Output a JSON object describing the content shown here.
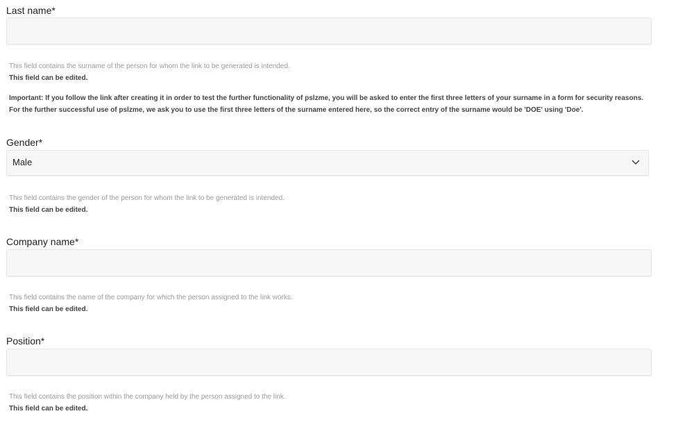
{
  "fields": {
    "last_name": {
      "label": "Last name*",
      "value": "",
      "help": "This field contains the surname of the person for whom the link to be generated is intended.",
      "editable_note": "This field can be edited.",
      "important_line1": "Important: If you follow the link after creating it in order to test the further functionality of pslzme, you will be asked to enter the first three letters of your surname in a form for security reasons.",
      "important_line2": "For the further successful use of pslzme, we ask you to use the first three letters of the surname entered here, so the correct entry of the surname would be 'DOE' using 'Doe'."
    },
    "gender": {
      "label": "Gender*",
      "selected": "Male",
      "help": "This field contains the gender of the person for whom the link to be generated is intended.",
      "editable_note": "This field can be edited."
    },
    "company_name": {
      "label": "Company name*",
      "value": "",
      "help": "This field contains the name of the company for which the person assigned to the link works.",
      "editable_note": "This field can be edited."
    },
    "position": {
      "label": "Position*",
      "value": "",
      "help": "This field contains the position within the company held by the person assigned to the link.",
      "editable_note": "This field can be edited."
    }
  },
  "icons": {
    "gender_dropdown": "chevron-down-icon"
  }
}
